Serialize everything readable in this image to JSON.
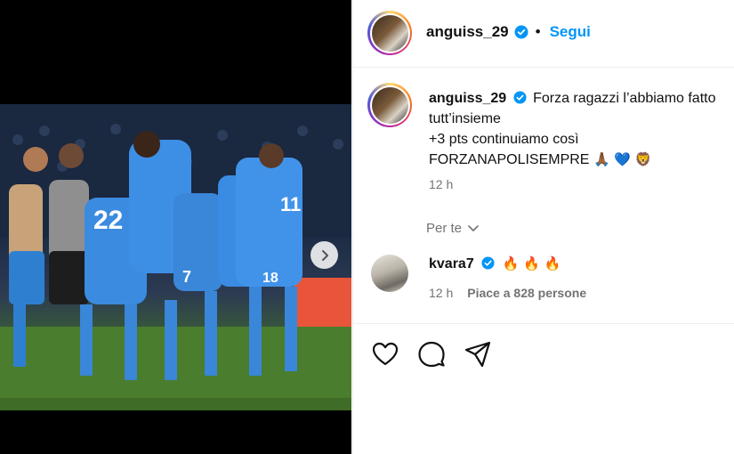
{
  "post": {
    "author": "anguiss_29",
    "follow_label": "Segui",
    "separator": "•"
  },
  "caption": {
    "author": "anguiss_29",
    "line1": "Forza ragazzi l’abbiamo fatto",
    "line2": "tutt’insieme",
    "line3": "+3 pts continuiamo così",
    "line4_text": "FORZANAPOLISEMPRE",
    "line4_emojis": "🙏🏾 💙 🦁",
    "time": "12 h"
  },
  "for_you_label": "Per te",
  "comment": {
    "author": "kvara7",
    "emojis": "🔥 🔥 🔥",
    "time": "12 h",
    "likes_label": "Piace a 828 persone"
  },
  "icons": {
    "like": "heart-icon",
    "comment": "comment-icon",
    "share": "send-icon",
    "verified": "verified-badge-icon",
    "next": "chevron-right-icon",
    "expand": "chevron-down-icon"
  },
  "colors": {
    "accent": "#0095f6",
    "muted": "#737373",
    "verified": "#0095f6"
  }
}
